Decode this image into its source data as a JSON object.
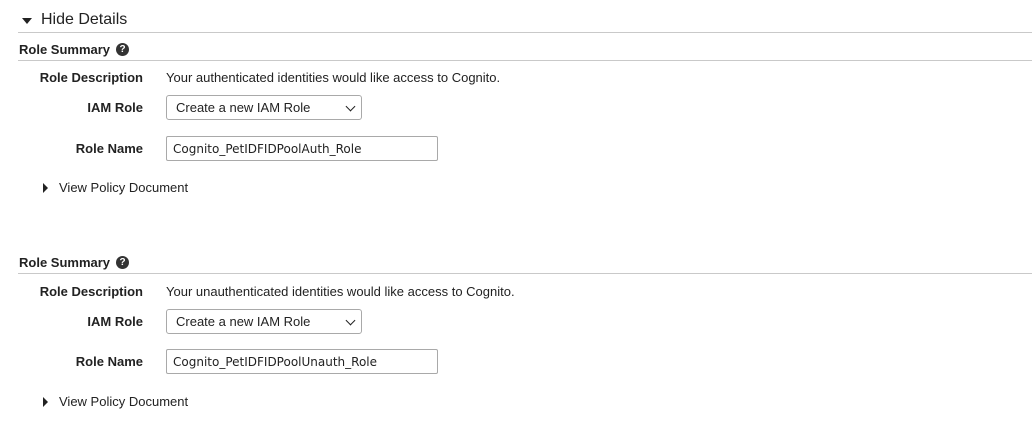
{
  "details_toggle": {
    "label": "Hide Details"
  },
  "sections": [
    {
      "title": "Role Summary",
      "help_icon": "question-circle-icon",
      "role_description_label": "Role Description",
      "role_description": "Your authenticated identities would like access to Cognito.",
      "iam_role_label": "IAM Role",
      "iam_role_selected": "Create a new IAM Role",
      "role_name_label": "Role Name",
      "role_name_value": "Cognito_PetIDFIDPoolAuth_Role",
      "policy_link": "View Policy Document"
    },
    {
      "title": "Role Summary",
      "help_icon": "question-circle-icon",
      "role_description_label": "Role Description",
      "role_description": "Your unauthenticated identities would like access to Cognito.",
      "iam_role_label": "IAM Role",
      "iam_role_selected": "Create a new IAM Role",
      "role_name_label": "Role Name",
      "role_name_value": "Cognito_PetIDFIDPoolUnauth_Role",
      "policy_link": "View Policy Document"
    }
  ]
}
